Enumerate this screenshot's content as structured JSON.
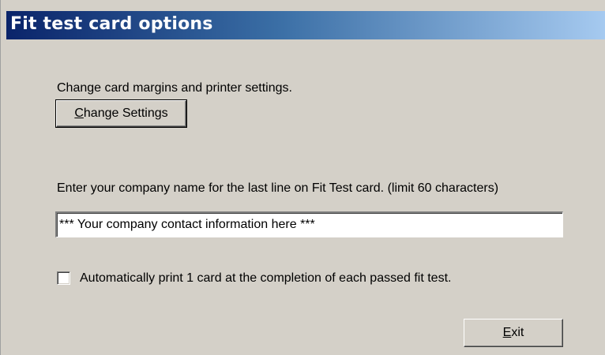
{
  "window": {
    "title": "Fit test card options"
  },
  "settings": {
    "description": "Change card margins and printer settings.",
    "button_label_mnemonic": "C",
    "button_label_rest": "hange Settings"
  },
  "company": {
    "description": "Enter your company name for the last line on Fit Test card. (limit 60 characters)",
    "value": "*** Your company contact information here ***"
  },
  "auto_print": {
    "label": "Automatically print 1 card at the completion of each passed fit test.",
    "checked": false
  },
  "exit_button": {
    "label_mnemonic": "E",
    "label_rest": "xit"
  },
  "colors": {
    "window_bg": "#d4d0c8",
    "title_gradient_start": "#0a246a",
    "title_gradient_end": "#a6caf0",
    "title_text": "#ffffff"
  }
}
